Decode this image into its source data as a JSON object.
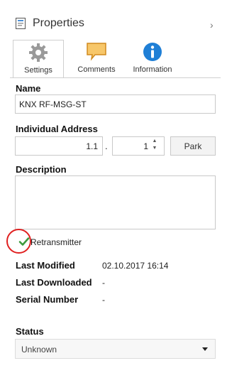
{
  "panel": {
    "title": "Properties",
    "collapse_icon": "chevron-right-icon"
  },
  "tabs": [
    {
      "label": "Settings",
      "icon": "gear-icon",
      "selected": true
    },
    {
      "label": "Comments",
      "icon": "comment-icon",
      "selected": false
    },
    {
      "label": "Information",
      "icon": "info-icon",
      "selected": false
    }
  ],
  "settings": {
    "name_label": "Name",
    "name_value": "KNX RF-MSG-ST",
    "address_label": "Individual Address",
    "address_area": "1.1",
    "address_separator": ".",
    "address_line": "1",
    "park_label": "Park",
    "description_label": "Description",
    "description_value": "",
    "retransmitter_label": "Retransmitter",
    "retransmitter_checked": true,
    "last_modified_label": "Last Modified",
    "last_modified_value": "02.10.2017 16:14",
    "last_downloaded_label": "Last Downloaded",
    "last_downloaded_value": "-",
    "serial_number_label": "Serial Number",
    "serial_number_value": "-",
    "status_label": "Status",
    "status_value": "Unknown"
  },
  "colors": {
    "highlight_circle": "#e02020",
    "checkmark": "#3d9a3d",
    "info_blue": "#1f7fd6",
    "comment_orange": "#f0a030"
  }
}
